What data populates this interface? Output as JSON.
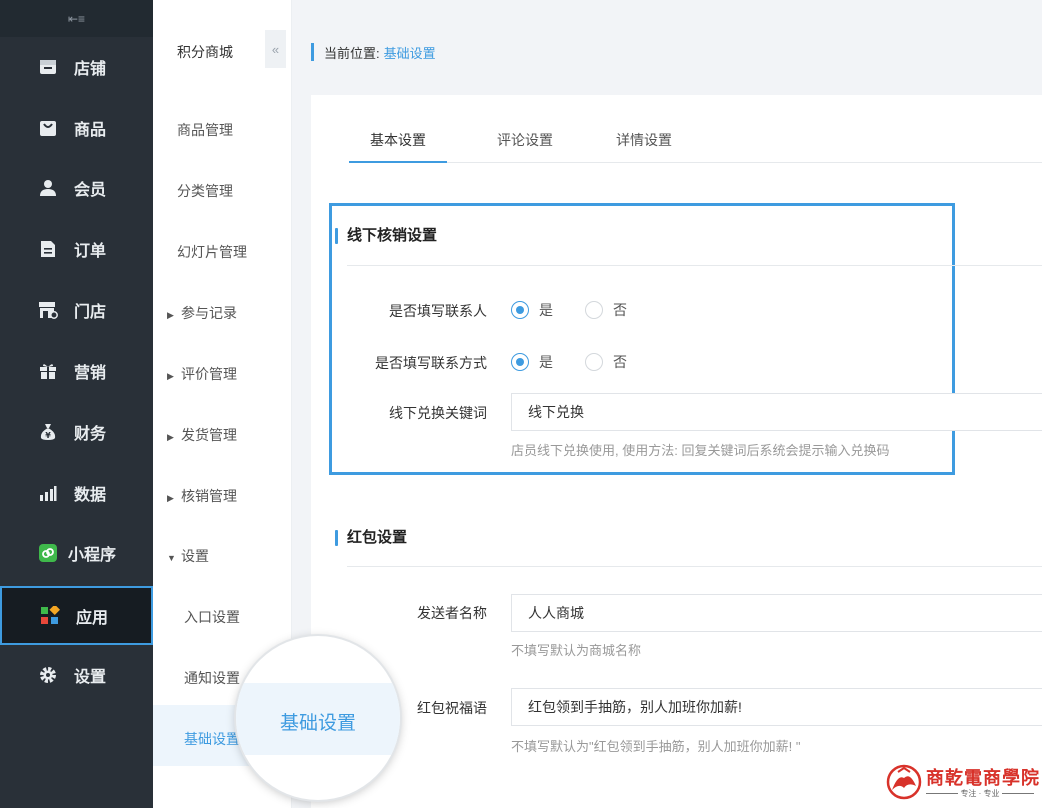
{
  "sidebar": {
    "collapse_glyph": "⇤≡",
    "items": [
      {
        "label": "店铺",
        "icon": "store-icon"
      },
      {
        "label": "商品",
        "icon": "bag-icon"
      },
      {
        "label": "会员",
        "icon": "user-icon"
      },
      {
        "label": "订单",
        "icon": "document-icon"
      },
      {
        "label": "门店",
        "icon": "shop-icon"
      },
      {
        "label": "营销",
        "icon": "gift-icon"
      },
      {
        "label": "财务",
        "icon": "money-bag-icon"
      },
      {
        "label": "数据",
        "icon": "bar-chart-icon"
      },
      {
        "label": "小程序",
        "icon": "mini-program-icon"
      },
      {
        "label": "应用",
        "icon": "apps-icon",
        "active": true
      },
      {
        "label": "设置",
        "icon": "gear-icon"
      }
    ]
  },
  "submenu": {
    "title": "积分商城",
    "collapse_glyph": "«",
    "items": [
      {
        "label": "商品管理"
      },
      {
        "label": "分类管理"
      },
      {
        "label": "幻灯片管理"
      },
      {
        "label": "参与记录",
        "arrow": "▶"
      },
      {
        "label": "评价管理",
        "arrow": "▶"
      },
      {
        "label": "发货管理",
        "arrow": "▶"
      },
      {
        "label": "核销管理",
        "arrow": "▶"
      },
      {
        "label": "设置",
        "arrow": "▼"
      },
      {
        "label": "入口设置"
      },
      {
        "label": "通知设置"
      },
      {
        "label": "基础设置",
        "active": true
      }
    ]
  },
  "breadcrumb": {
    "prefix": "当前位置:",
    "current": "基础设置"
  },
  "tabs": [
    {
      "label": "基本设置",
      "active": true
    },
    {
      "label": "评论设置"
    },
    {
      "label": "详情设置"
    }
  ],
  "offline_section": {
    "title": "线下核销设置",
    "fields": [
      {
        "label": "是否填写联系人",
        "options": [
          "是",
          "否"
        ],
        "selected": "是"
      },
      {
        "label": "是否填写联系方式",
        "options": [
          "是",
          "否"
        ],
        "selected": "是"
      }
    ],
    "keyword": {
      "label": "线下兑换关键词",
      "value": "线下兑换",
      "hint": "店员线下兑换使用, 使用方法: 回复关键词后系统会提示输入兑换码"
    }
  },
  "redpacket_section": {
    "title": "红包设置",
    "sender": {
      "label": "发送者名称",
      "value": "人人商城",
      "hint": "不填写默认为商城名称"
    },
    "blessing": {
      "label": "红包祝福语",
      "value": "红包领到手抽筋，别人加班你加薪!",
      "hint": "不填写默认为\"红包领到手抽筋，别人加班你加薪! \""
    }
  },
  "magnifier": {
    "label": "基础设置"
  },
  "watermark": {
    "name": "商乾電商學院",
    "tagline": "专注 · 专业"
  },
  "colors": {
    "accent": "#3e9be0",
    "sidebar_bg": "#293038",
    "watermark_red": "#d8322a"
  }
}
